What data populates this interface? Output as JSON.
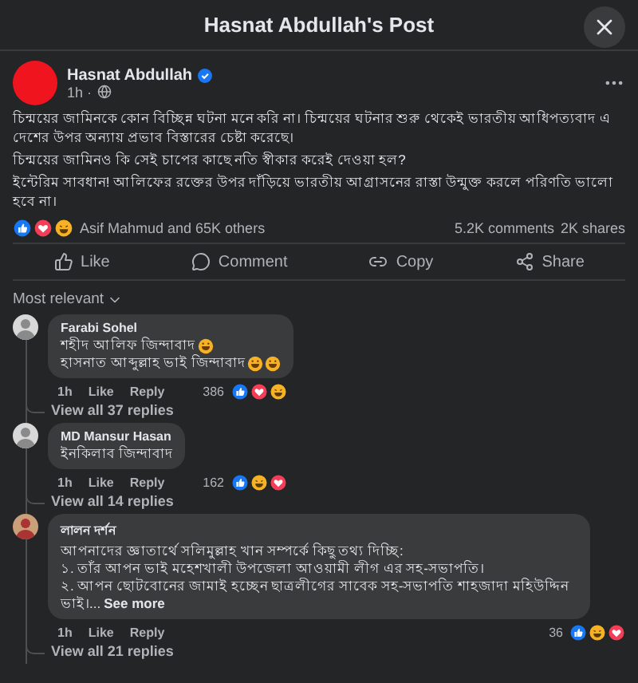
{
  "header": {
    "title": "Hasnat Abdullah's Post"
  },
  "post": {
    "author": "Hasnat Abdullah",
    "verified": true,
    "time": "1h ·",
    "paragraphs": [
      "চিন্ময়ের জামিনকে কোন বিচ্ছিন্ন ঘটনা মনে করি না। চিন্ময়ের ঘটনার শুরু থেকেই ভারতীয় আধিপত্যবাদ এ দেশের উপর অন্যায় প্রভাব বিস্তারের চেষ্টা করেছে।",
      "চিন্ময়ের জামিনও কি সেই চাপের কাছে নতি স্বীকার করেই দেওয়া হল?",
      "ইন্টেরিম সাবধান! আলিফের রক্তের উপর দাঁড়িয়ে ভারতীয় আগ্রাসনের রাস্তা উন্মুক্ত করলে পরিণতি ভালো হবে না।"
    ],
    "reacted_by": "Asif Mahmud and 65K others",
    "comments_count": "5.2K comments",
    "shares_count": "2K shares"
  },
  "actions": [
    {
      "kind": "like",
      "label": "Like"
    },
    {
      "kind": "comment",
      "label": "Comment"
    },
    {
      "kind": "copy",
      "label": "Copy"
    },
    {
      "kind": "share",
      "label": "Share"
    }
  ],
  "sort": "Most relevant",
  "comments": [
    {
      "author": "Farabi Sohel",
      "lines": [
        {
          "text": "শহীদ আলিফ জিন্দাবাদ"
        },
        {
          "text": "হাসনাত আব্দুল্লাহ ভাই জিন্দাবাদ"
        }
      ],
      "time": "1h",
      "like": "Like",
      "reply": "Reply",
      "count": "386",
      "replies": "View all 37 replies"
    },
    {
      "author": "MD Mansur Hasan",
      "lines": [
        {
          "text": "ইনকিলাব জিন্দাবাদ"
        }
      ],
      "time": "1h",
      "like": "Like",
      "reply": "Reply",
      "count": "162",
      "replies": "View all 14 replies"
    },
    {
      "author": "লালন দর্শন",
      "lines": [
        {
          "text": "আপনাদের জ্ঞাতার্থে সলিমুল্লাহ খান সম্পর্কে কিছু তথ্য দিচ্ছি:"
        },
        {
          "text": "১. তাঁর আপন ভাই মহেশখালী উপজেলা আওয়ামী লীগ এর সহ-সভাপতি।"
        },
        {
          "text": "২. আপন ছোটবোনের জামাই হচ্ছেন ছাত্রলীগের সাবেক সহ-সভাপতি শাহজাদা মহিউদ্দিন ভাই।...",
          "more": "See more"
        }
      ],
      "time": "1h",
      "like": "Like",
      "reply": "Reply",
      "count": "36",
      "replies": "View all 21 replies"
    }
  ]
}
